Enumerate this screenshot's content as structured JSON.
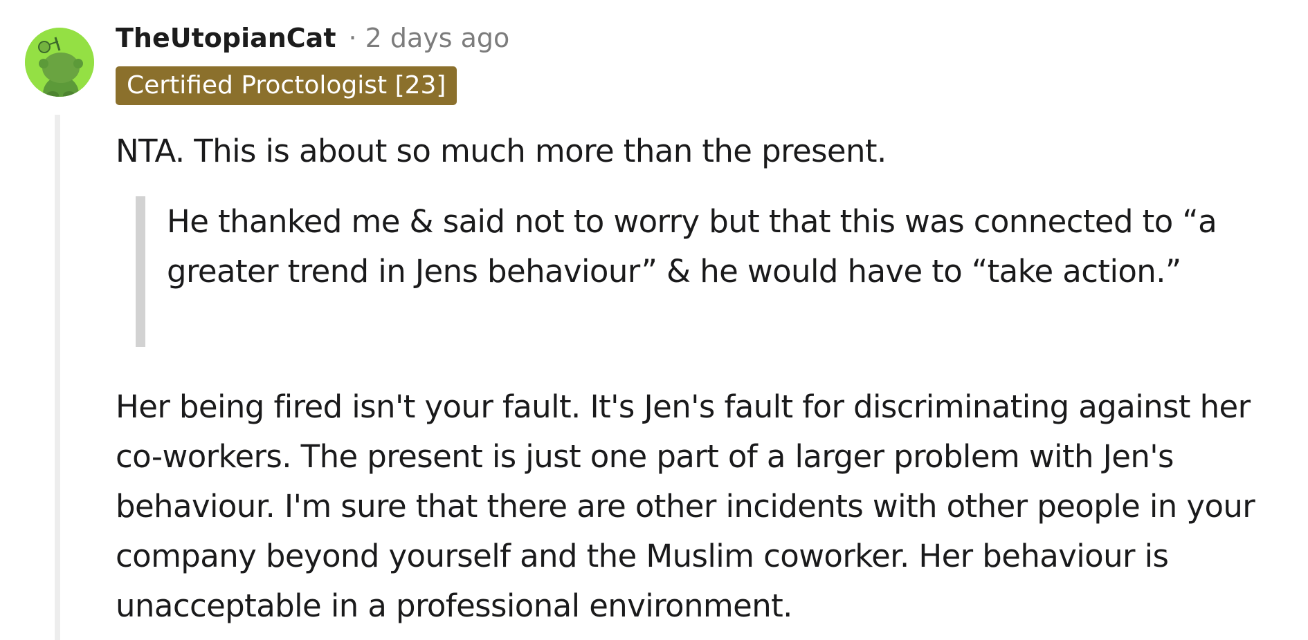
{
  "comment": {
    "author": "TheUtopianCat",
    "separator": "·",
    "timestamp": "2 days ago",
    "flair": "Certified Proctologist [23]",
    "avatar_icon": "snoo-avatar-icon",
    "colors": {
      "flair_bg": "#8b702c",
      "avatar_bg": "#94e044",
      "meta_text": "#7c7c7c",
      "quote_bar": "#d2d2d2",
      "thread_line": "#ededed"
    },
    "body": {
      "paragraph_1": "NTA. This is about so much more than the present.",
      "quote": "He thanked me & said not to worry but that this was connected to “a greater trend in Jens behaviour” & he would have to “take action.”",
      "paragraph_2": "Her being fired isn't your fault. It's Jen's fault for discriminating against her co-workers. The present is just one part of a larger problem with Jen's behaviour. I'm sure that there are other incidents with other people in your company beyond yourself and the Muslim coworker. Her behaviour is unacceptable in a professional environment."
    }
  }
}
